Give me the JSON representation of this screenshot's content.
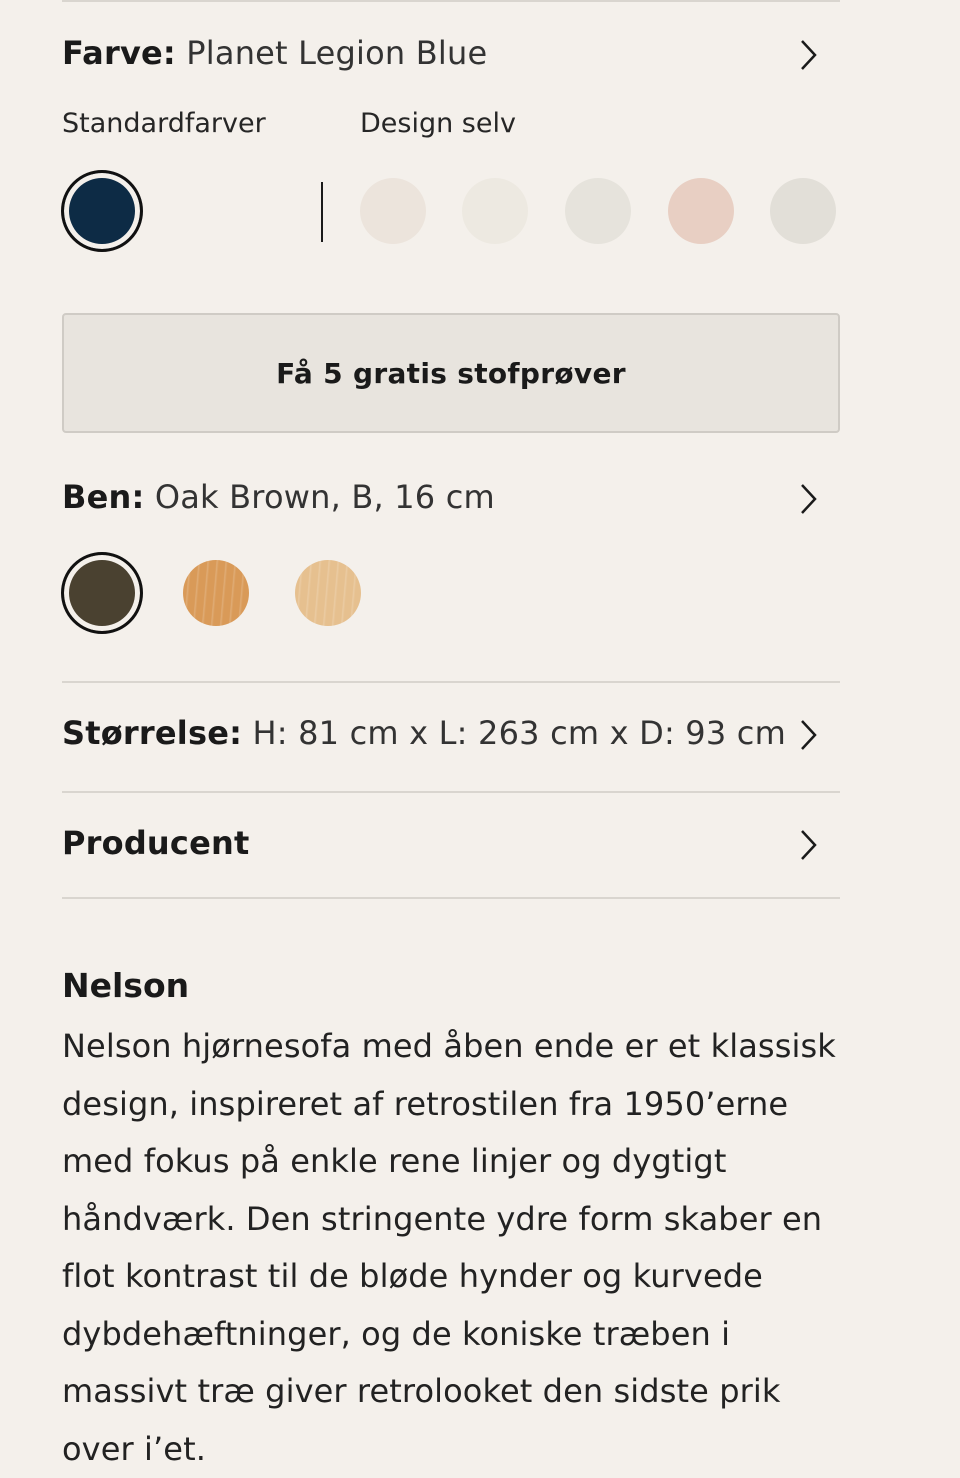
{
  "colour": {
    "label": "Farve:",
    "value": "Planet Legion Blue",
    "tab_standard": "Standardfarver",
    "tab_design": "Design selv",
    "selected_swatch": {
      "name": "Planet Legion Blue",
      "color": "#0d2b45"
    },
    "design_swatches": [
      {
        "color": "#ece4dc"
      },
      {
        "color": "#ede9e1"
      },
      {
        "color": "#e6e3dc"
      },
      {
        "color": "#e8cfc3"
      },
      {
        "color": "#e2dfd8"
      }
    ]
  },
  "samples_button": "Få 5 gratis stofprøver",
  "legs": {
    "label": "Ben:",
    "value": "Oak Brown, B, 16 cm",
    "swatches": [
      {
        "name": "Oak Brown",
        "color": "#4a4130",
        "selected": true
      },
      {
        "color": "#d99a58"
      },
      {
        "color": "#e6c08f"
      }
    ]
  },
  "size": {
    "label": "Størrelse:",
    "value": "H: 81 cm x L: 263 cm x D: 93 cm"
  },
  "producer": {
    "label": "Producent"
  },
  "description": {
    "title": "Nelson",
    "text": "Nelson hjørnesofa med åben ende er et klassisk design, inspireret af retrostilen fra 1950’erne med fokus på enkle rene linjer og dygtigt håndværk. Den stringente ydre form skaber en flot kontrast til de bløde hynder og kurvede dybdehæftninger, og de koniske træben i massivt træ giver retrolooket den sidste prik over i’et."
  }
}
